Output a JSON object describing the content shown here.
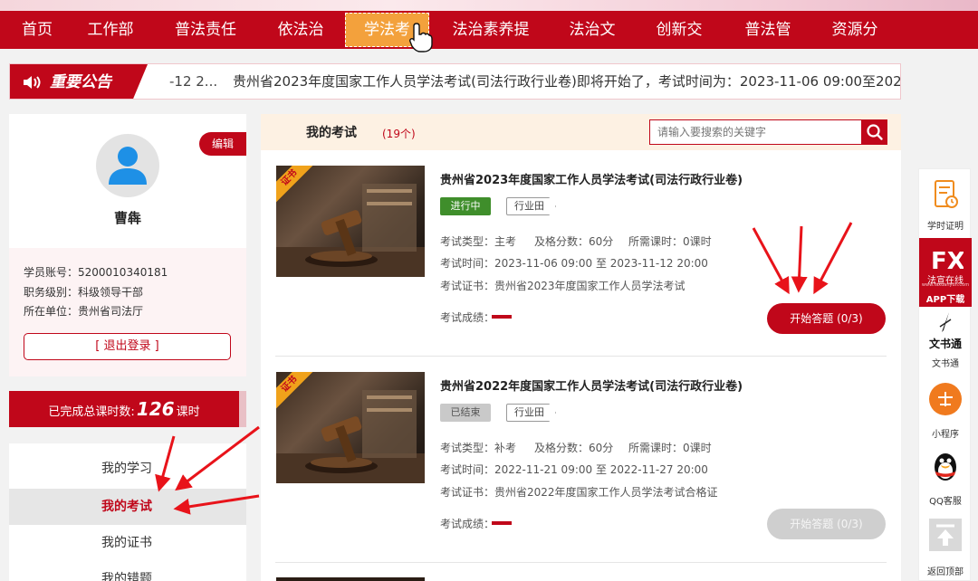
{
  "nav": {
    "items": [
      {
        "label": "首页"
      },
      {
        "label": "工作部"
      },
      {
        "label": "普法责任"
      },
      {
        "label": "依法治"
      },
      {
        "label": "学法考"
      },
      {
        "label": "法治素养提"
      },
      {
        "label": "法治文"
      },
      {
        "label": "创新交"
      },
      {
        "label": "普法管"
      },
      {
        "label": "资源分"
      }
    ],
    "active_index": 4
  },
  "notice": {
    "badge": "重要公告",
    "date": "-12 2...",
    "text": "贵州省2023年度国家工作人员学法考试(司法行政行业卷)即将开始了，考试时间为：2023-11-06 09:00至2023-1"
  },
  "profile": {
    "edit_label": "编辑",
    "name": "曹犇",
    "account": "学员账号：5200010340181",
    "level": "职务级别：科级领导干部",
    "unit": "所在单位：贵州省司法厅",
    "logout_label": "[ 退出登录 ]"
  },
  "hours": {
    "prefix": "已完成总课时数:",
    "value": "126",
    "suffix": "课时"
  },
  "menu": {
    "items": [
      {
        "label": "我的学习"
      },
      {
        "label": "我的考试"
      },
      {
        "label": "我的证书"
      },
      {
        "label": "我的错题"
      }
    ],
    "active_index": 1
  },
  "main": {
    "title": "我的考试",
    "count": "(19个)",
    "search_placeholder": "请输入要搜索的关键字"
  },
  "exams": [
    {
      "ribbon": "证书",
      "title": "贵州省2023年度国家工作人员学法考试(司法行政行业卷)",
      "status": "进行中",
      "tag": "行业田",
      "type": "考试类型：主考",
      "pass": "及格分数：60分",
      "hours": "所需课时：0课时",
      "time": "考试时间：2023-11-06 09:00 至 2023-11-12 20:00",
      "cert": "考试证书：贵州省2023年度国家工作人员学法考试",
      "score_label": "考试成绩：",
      "button": "开始答题 (0/3)"
    },
    {
      "ribbon": "证书",
      "title": "贵州省2022年度国家工作人员学法考试(司法行政行业卷)",
      "status": "已结束",
      "tag": "行业田",
      "type": "考试类型：补考",
      "pass": "及格分数：60分",
      "hours": "所需课时：0课时",
      "time": "考试时间：2022-11-21 09:00 至 2022-11-27 20:00",
      "cert": "考试证书：贵州省2022年度国家工作人员学法考试合格证",
      "score_label": "考试成绩：",
      "button": "开始答题 (0/3)"
    }
  ],
  "right_bar": {
    "items": [
      {
        "label": "学时证明"
      },
      {
        "label": "APP下载",
        "brand": "法宣在线",
        "sub": "www.faxuanyun.com"
      },
      {
        "label": "文书通",
        "title": "文书通"
      },
      {
        "label": "小程序"
      },
      {
        "label": "QQ客服"
      },
      {
        "label": "返回顶部"
      }
    ]
  },
  "colors": {
    "brand_red": "#c0071a",
    "nav_active": "#f3a13c",
    "running_green": "#3f8e2b"
  }
}
